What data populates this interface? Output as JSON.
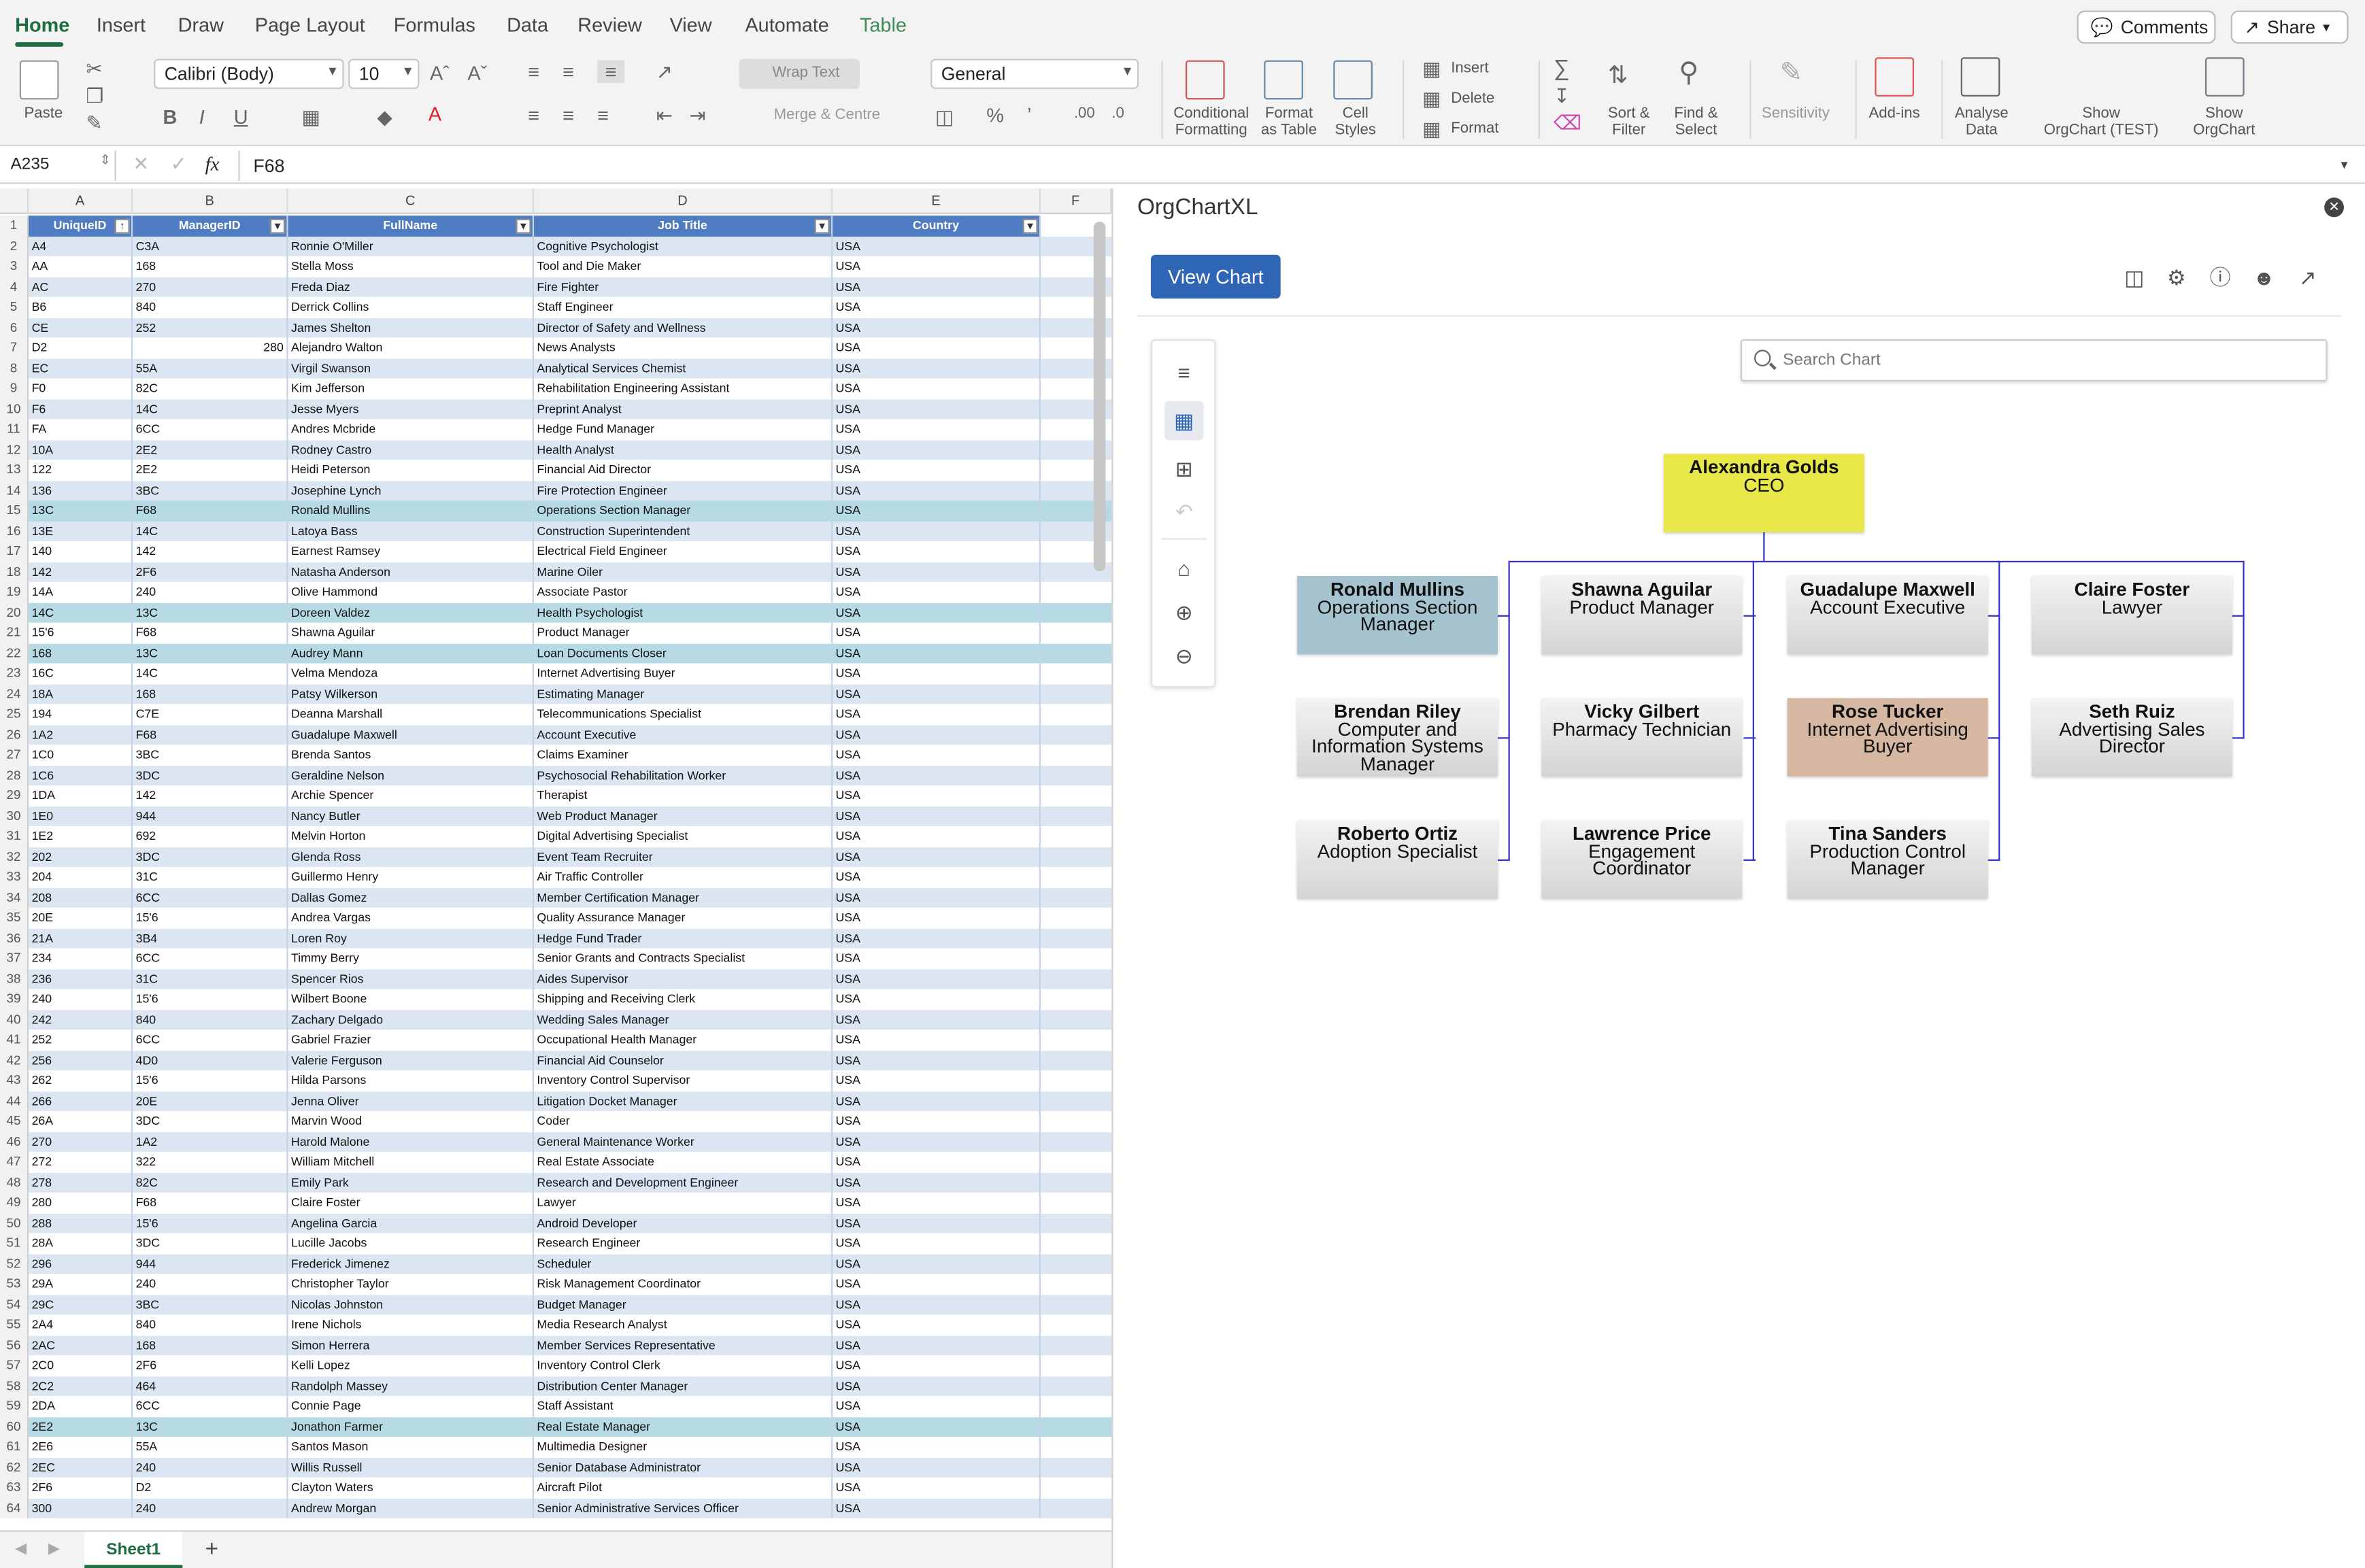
{
  "ribbon": {
    "tabs": [
      "Home",
      "Insert",
      "Draw",
      "Page Layout",
      "Formulas",
      "Data",
      "Review",
      "View",
      "Automate",
      "Table"
    ],
    "comments_label": "Comments",
    "share_label": "Share",
    "paste_label": "Paste",
    "font_name": "Calibri (Body)",
    "font_size": "10",
    "wrap_text": "Wrap Text",
    "merge_centre": "Merge & Centre",
    "number_format": "General",
    "insert": "Insert",
    "delete": "Delete",
    "format": "Format",
    "conditional_formatting": "Conditional\nFormatting",
    "format_as_table": "Format\nas Table",
    "cell_styles": "Cell\nStyles",
    "sort_filter": "Sort &\nFilter",
    "find_select": "Find &\nSelect",
    "sensitivity": "Sensitivity",
    "add_ins": "Add-ins",
    "analyse_data": "Analyse\nData",
    "show_orgchart_test": "Show\nOrgChart (TEST)",
    "show_orgchart": "Show\nOrgChart"
  },
  "formula_bar": {
    "cell_ref": "A235",
    "fx": "fx",
    "value": "F68"
  },
  "sheet": {
    "columns": [
      "A",
      "B",
      "C",
      "D",
      "E",
      "F"
    ],
    "headers": [
      "UniqueID",
      "ManagerID",
      "FullName",
      "Job Title",
      "Country"
    ],
    "rows": [
      [
        "A4",
        "C3A",
        "Ronnie O'Miller",
        "Cognitive Psychologist",
        "USA"
      ],
      [
        "AA",
        "168",
        "Stella Moss",
        "Tool and Die Maker",
        "USA"
      ],
      [
        "AC",
        "270",
        "Freda Diaz",
        "Fire Fighter",
        "USA"
      ],
      [
        "B6",
        "840",
        "Derrick Collins",
        "Staff Engineer",
        "USA"
      ],
      [
        "CE",
        "252",
        "James Shelton",
        "Director of Safety and Wellness",
        "USA"
      ],
      [
        "D2",
        "280",
        "Alejandro Walton",
        "News Analysts",
        "USA"
      ],
      [
        "EC",
        "55A",
        "Virgil Swanson",
        "Analytical Services Chemist",
        "USA"
      ],
      [
        "F0",
        "82C",
        "Kim Jefferson",
        "Rehabilitation Engineering Assistant",
        "USA"
      ],
      [
        "F6",
        "14C",
        "Jesse Myers",
        "Preprint Analyst",
        "USA"
      ],
      [
        "FA",
        "6CC",
        "Andres Mcbride",
        "Hedge Fund Manager",
        "USA"
      ],
      [
        "10A",
        "2E2",
        "Rodney Castro",
        "Health Analyst",
        "USA"
      ],
      [
        "122",
        "2E2",
        "Heidi Peterson",
        "Financial Aid Director",
        "USA"
      ],
      [
        "136",
        "3BC",
        "Josephine Lynch",
        "Fire Protection Engineer",
        "USA"
      ],
      [
        "13C",
        "F68",
        "Ronald Mullins",
        "Operations Section Manager",
        "USA"
      ],
      [
        "13E",
        "14C",
        "Latoya Bass",
        "Construction Superintendent",
        "USA"
      ],
      [
        "140",
        "142",
        "Earnest Ramsey",
        "Electrical Field Engineer",
        "USA"
      ],
      [
        "142",
        "2F6",
        "Natasha Anderson",
        "Marine Oiler",
        "USA"
      ],
      [
        "14A",
        "240",
        "Olive Hammond",
        "Associate Pastor",
        "USA"
      ],
      [
        "14C",
        "13C",
        "Doreen Valdez",
        "Health Psychologist",
        "USA"
      ],
      [
        "15'6",
        "F68",
        "Shawna Aguilar",
        "Product Manager",
        "USA"
      ],
      [
        "168",
        "13C",
        "Audrey Mann",
        "Loan Documents Closer",
        "USA"
      ],
      [
        "16C",
        "14C",
        "Velma Mendoza",
        "Internet Advertising Buyer",
        "USA"
      ],
      [
        "18A",
        "168",
        "Patsy Wilkerson",
        "Estimating Manager",
        "USA"
      ],
      [
        "194",
        "C7E",
        "Deanna Marshall",
        "Telecommunications Specialist",
        "USA"
      ],
      [
        "1A2",
        "F68",
        "Guadalupe Maxwell",
        "Account Executive",
        "USA"
      ],
      [
        "1C0",
        "3BC",
        "Brenda Santos",
        "Claims Examiner",
        "USA"
      ],
      [
        "1C6",
        "3DC",
        "Geraldine Nelson",
        "Psychosocial Rehabilitation Worker",
        "USA"
      ],
      [
        "1DA",
        "142",
        "Archie Spencer",
        "Therapist",
        "USA"
      ],
      [
        "1E0",
        "944",
        "Nancy Butler",
        "Web Product Manager",
        "USA"
      ],
      [
        "1E2",
        "692",
        "Melvin Horton",
        "Digital Advertising Specialist",
        "USA"
      ],
      [
        "202",
        "3DC",
        "Glenda Ross",
        "Event Team Recruiter",
        "USA"
      ],
      [
        "204",
        "31C",
        "Guillermo Henry",
        "Air Traffic Controller",
        "USA"
      ],
      [
        "208",
        "6CC",
        "Dallas Gomez",
        "Member Certification Manager",
        "USA"
      ],
      [
        "20E",
        "15'6",
        "Andrea Vargas",
        "Quality Assurance Manager",
        "USA"
      ],
      [
        "21A",
        "3B4",
        "Loren Roy",
        "Hedge Fund Trader",
        "USA"
      ],
      [
        "234",
        "6CC",
        "Timmy Berry",
        "Senior Grants and Contracts Specialist",
        "USA"
      ],
      [
        "236",
        "31C",
        "Spencer Rios",
        "Aides Supervisor",
        "USA"
      ],
      [
        "240",
        "15'6",
        "Wilbert Boone",
        "Shipping and Receiving Clerk",
        "USA"
      ],
      [
        "242",
        "840",
        "Zachary Delgado",
        "Wedding Sales Manager",
        "USA"
      ],
      [
        "252",
        "6CC",
        "Gabriel Frazier",
        "Occupational Health Manager",
        "USA"
      ],
      [
        "256",
        "4D0",
        "Valerie Ferguson",
        "Financial Aid Counselor",
        "USA"
      ],
      [
        "262",
        "15'6",
        "Hilda Parsons",
        "Inventory Control Supervisor",
        "USA"
      ],
      [
        "266",
        "20E",
        "Jenna Oliver",
        "Litigation Docket Manager",
        "USA"
      ],
      [
        "26A",
        "3DC",
        "Marvin Wood",
        "Coder",
        "USA"
      ],
      [
        "270",
        "1A2",
        "Harold Malone",
        "General Maintenance Worker",
        "USA"
      ],
      [
        "272",
        "322",
        "William Mitchell",
        "Real Estate Associate",
        "USA"
      ],
      [
        "278",
        "82C",
        "Emily Park",
        "Research and Development Engineer",
        "USA"
      ],
      [
        "280",
        "F68",
        "Claire Foster",
        "Lawyer",
        "USA"
      ],
      [
        "288",
        "15'6",
        "Angelina Garcia",
        "Android Developer",
        "USA"
      ],
      [
        "28A",
        "3DC",
        "Lucille Jacobs",
        "Research Engineer",
        "USA"
      ],
      [
        "296",
        "944",
        "Frederick Jimenez",
        "Scheduler",
        "USA"
      ],
      [
        "29A",
        "240",
        "Christopher Taylor",
        "Risk Management Coordinator",
        "USA"
      ],
      [
        "29C",
        "3BC",
        "Nicolas Johnston",
        "Budget Manager",
        "USA"
      ],
      [
        "2A4",
        "840",
        "Irene Nichols",
        "Media Research Analyst",
        "USA"
      ],
      [
        "2AC",
        "168",
        "Simon Herrera",
        "Member Services Representative",
        "USA"
      ],
      [
        "2C0",
        "2F6",
        "Kelli Lopez",
        "Inventory Control Clerk",
        "USA"
      ],
      [
        "2C2",
        "464",
        "Randolph Massey",
        "Distribution Center Manager",
        "USA"
      ],
      [
        "2DA",
        "6CC",
        "Connie Page",
        "Staff Assistant",
        "USA"
      ],
      [
        "2E2",
        "13C",
        "Jonathon Farmer",
        "Real Estate Manager",
        "USA"
      ],
      [
        "2E6",
        "55A",
        "Santos Mason",
        "Multimedia Designer",
        "USA"
      ],
      [
        "2EC",
        "240",
        "Willis Russell",
        "Senior Database Administrator",
        "USA"
      ],
      [
        "2F6",
        "D2",
        "Clayton Waters",
        "Aircraft Pilot",
        "USA"
      ],
      [
        "300",
        "240",
        "Andrew Morgan",
        "Senior Administrative Services Officer",
        "USA"
      ]
    ],
    "sheet_tab": "Sheet1",
    "add_sheet": "+"
  },
  "pane": {
    "title": "OrgChartXL",
    "view_chart": "View Chart",
    "search_placeholder": "Search Chart",
    "colors": {
      "ceo": "#e8e84a",
      "highlight_blue": "#a6c4cf",
      "highlight_tan": "#d6b8a2",
      "connector": "#3333cc"
    },
    "ceo": {
      "name": "Alexandra Golds",
      "title": "CEO"
    },
    "nodes": [
      {
        "name": "Ronald Mullins",
        "title": "Operations Section Manager"
      },
      {
        "name": "Shawna Aguilar",
        "title": "Product Manager"
      },
      {
        "name": "Guadalupe Maxwell",
        "title": "Account Executive"
      },
      {
        "name": "Claire Foster",
        "title": "Lawyer"
      },
      {
        "name": "Brendan Riley",
        "title": "Computer and Information Systems Manager"
      },
      {
        "name": "Vicky Gilbert",
        "title": "Pharmacy Technician"
      },
      {
        "name": "Rose Tucker",
        "title": "Internet Advertising Buyer"
      },
      {
        "name": "Seth Ruiz",
        "title": "Advertising Sales Director"
      },
      {
        "name": "Roberto Ortiz",
        "title": "Adoption Specialist"
      },
      {
        "name": "Lawrence Price",
        "title": "Engagement Coordinator"
      },
      {
        "name": "Tina Sanders",
        "title": "Production Control Manager"
      }
    ]
  }
}
